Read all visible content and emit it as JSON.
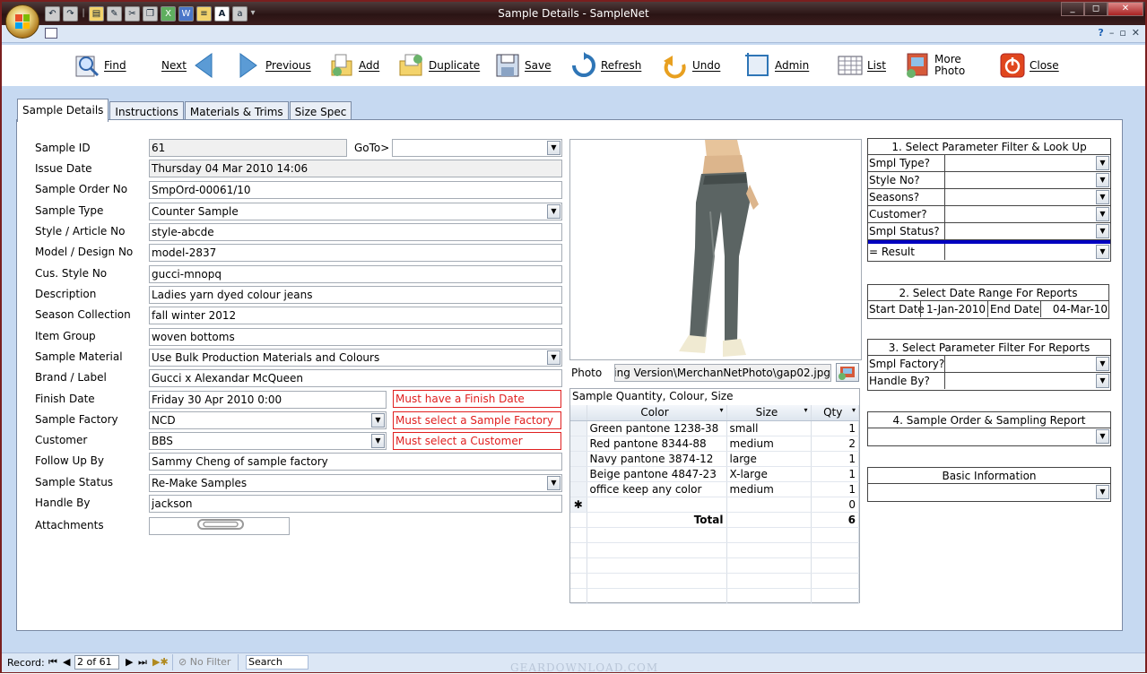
{
  "window": {
    "title": "Sample Details - SampleNet",
    "minimize": "_",
    "restore": "◻",
    "close": "✕"
  },
  "qat_icons": [
    "undo-icon",
    "redo-icon",
    "folder-icon",
    "tools-icon",
    "cut-icon",
    "copy-icon",
    "excel-icon",
    "word-icon",
    "report-icon",
    "font-a-icon",
    "text-icon"
  ],
  "toolbar": {
    "find": "Find",
    "next": "Next",
    "previous": "Previous",
    "add": "Add",
    "duplicate": "Duplicate",
    "save": "Save",
    "refresh": "Refresh",
    "undo": "Undo",
    "admin": "Admin",
    "list": "List",
    "more_photo_1": "More",
    "more_photo_2": "Photo",
    "close": "Close"
  },
  "tabs": [
    "Sample Details",
    "Instructions",
    "Materials & Trims",
    "Size Spec"
  ],
  "form": {
    "sample_id": {
      "label": "Sample ID",
      "value": "61"
    },
    "goto": {
      "label": "GoTo>",
      "value": ""
    },
    "issue_date": {
      "label": "Issue Date",
      "value": "Thursday 04 Mar 2010  14:06"
    },
    "sample_order_no": {
      "label": "Sample Order No",
      "value": "SmpOrd-00061/10"
    },
    "sample_type": {
      "label": "Sample Type",
      "value": "Counter Sample"
    },
    "style_article_no": {
      "label": "Style / Article No",
      "value": "style-abcde"
    },
    "model_design_no": {
      "label": "Model / Design No",
      "value": "model-2837"
    },
    "cus_style_no": {
      "label": "Cus. Style No",
      "value": "gucci-mnopq"
    },
    "description": {
      "label": "Description",
      "value": "Ladies yarn dyed colour jeans"
    },
    "season_collection": {
      "label": "Season Collection",
      "value": "fall winter 2012"
    },
    "item_group": {
      "label": "Item Group",
      "value": "woven bottoms"
    },
    "sample_material": {
      "label": "Sample Material",
      "value": "Use Bulk Production Materials and Colours"
    },
    "brand_label": {
      "label": "Brand / Label",
      "value": "Gucci x Alexandar McQueen"
    },
    "finish_date": {
      "label": "Finish Date",
      "value": "Friday 30 Apr 2010  0:00",
      "error": "Must have a Finish Date"
    },
    "sample_factory": {
      "label": "Sample Factory",
      "value": "NCD",
      "error": "Must select a Sample Factory"
    },
    "customer": {
      "label": "Customer",
      "value": "BBS",
      "error": "Must select a Customer"
    },
    "follow_up_by": {
      "label": "Follow Up By",
      "value": "Sammy Cheng of sample factory"
    },
    "sample_status": {
      "label": "Sample Status",
      "value": "Re-Make Samples"
    },
    "handle_by": {
      "label": "Handle By",
      "value": "jackson"
    },
    "attachments": {
      "label": "Attachments"
    }
  },
  "photo": {
    "label": "Photo",
    "path": "king Version\\MerchanNetPhoto\\gap02.jpg"
  },
  "quantity_grid": {
    "title": "Sample Quantity, Colour, Size",
    "headers": [
      "Color",
      "Size",
      "Qty"
    ],
    "rows": [
      {
        "color": "Green pantone 1238-38",
        "size": "small",
        "qty": "1"
      },
      {
        "color": "Red pantone 8344-88",
        "size": "medium",
        "qty": "2"
      },
      {
        "color": "Navy pantone 3874-12",
        "size": "large",
        "qty": "1"
      },
      {
        "color": "Beige pantone 4847-23",
        "size": "X-large",
        "qty": "1"
      },
      {
        "color": "office keep any color",
        "size": "medium",
        "qty": "1"
      }
    ],
    "new_row_marker": "✱",
    "new_row_qty": "0",
    "total_label": "Total",
    "total_qty": "6"
  },
  "filter1": {
    "title": "1. Select Parameter Filter & Look Up",
    "params": [
      "Smpl Type?",
      "Style No?",
      "Seasons?",
      "Customer?",
      "Smpl Status?"
    ],
    "result_label": "= Result"
  },
  "filter2": {
    "title": "2. Select Date Range For  Reports",
    "start_label": "Start Date",
    "start_value": "1-Jan-2010",
    "end_label": "End Date",
    "end_value": "04-Mar-10"
  },
  "filter3": {
    "title": "3. Select Parameter Filter For Reports",
    "params": [
      "Smpl Factory?",
      "Handle By?"
    ]
  },
  "filter4": {
    "title": "4. Sample Order & Sampling Report"
  },
  "basic_info": {
    "title": "Basic Information"
  },
  "statusbar": {
    "record_label": "Record:",
    "record_value": "2 of 61",
    "no_filter": "No Filter",
    "search": "Search"
  },
  "watermark": "GEARDOWNLOAD.COM",
  "colors": {
    "error": "#e02020",
    "result_bar": "#0000c0",
    "frame": "#c6d9f1",
    "title_bg": "#2a1414"
  }
}
